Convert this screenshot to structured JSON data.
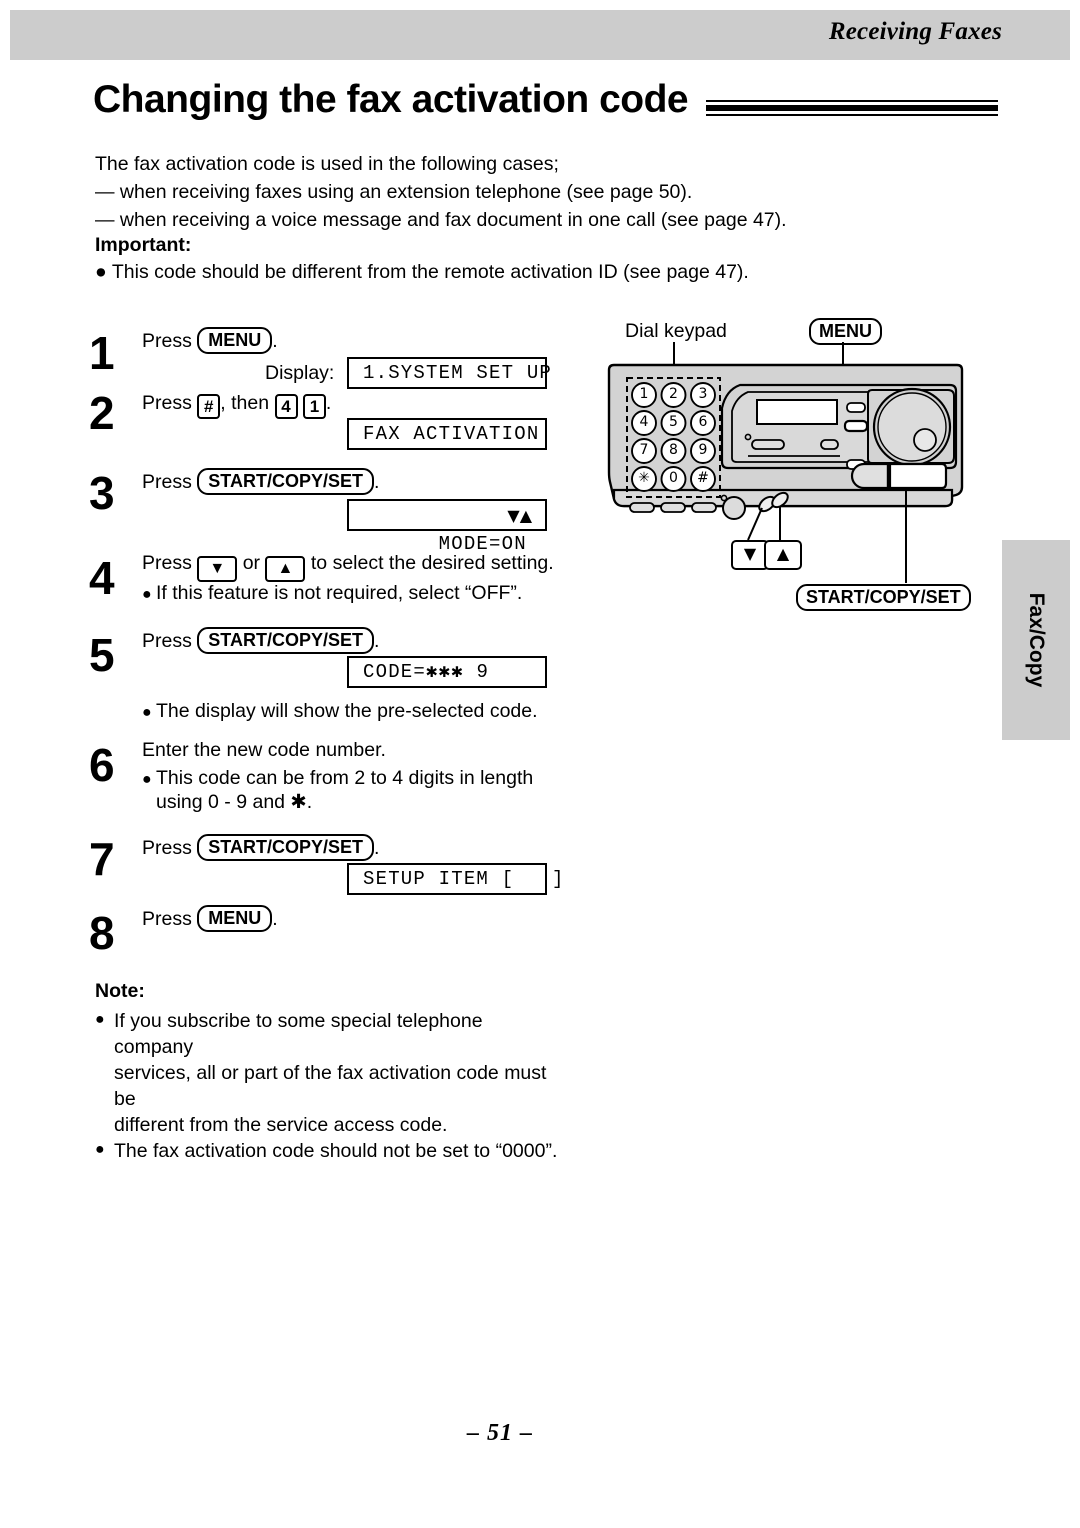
{
  "header": {
    "section_title": "Receiving Faxes"
  },
  "title": "Changing the fax activation code",
  "intro": {
    "line1": "The fax activation code is used in the following cases;",
    "line2": "— when receiving faxes using an extension telephone (see page 50).",
    "line3": "— when receiving a voice message and fax document in one call (see page 47)."
  },
  "important": {
    "label": "Important:",
    "item1": "This code should be different from the remote activation ID (see page 47)."
  },
  "steps": {
    "s1": {
      "num": "1",
      "press": "Press",
      "key": "MENU",
      "period": ".",
      "display_label": "Display:",
      "lcd": "1.SYSTEM SET UP"
    },
    "s2": {
      "num": "2",
      "press": "Press",
      "key_hash": "#",
      "then": ", then",
      "key_4": "4",
      "key_1": "1",
      "period": ".",
      "lcd": "FAX ACTIVATION"
    },
    "s3": {
      "num": "3",
      "press": "Press",
      "key": "START/COPY/SET",
      "period": ".",
      "lcd": "MODE=ON",
      "lcd_arrows": "▼▲"
    },
    "s4": {
      "num": "4",
      "press": "Press",
      "key_down": "▼",
      "or": "or",
      "key_up": "▲",
      "tail": "to select the desired setting.",
      "bullet1": "If this feature is not required, select “OFF”."
    },
    "s5": {
      "num": "5",
      "press": "Press",
      "key": "START/COPY/SET",
      "period": ".",
      "lcd": "CODE=✱✱✱ 9",
      "bullet1": "The display will show the pre-selected code."
    },
    "s6": {
      "num": "6",
      "text": "Enter the new code number.",
      "bullet1": "This code can be from 2 to 4 digits in length",
      "bullet1_cont": "using 0 - 9 and ✱."
    },
    "s7": {
      "num": "7",
      "press": "Press",
      "key": "START/COPY/SET",
      "period": ".",
      "lcd": "SETUP ITEM [   ]"
    },
    "s8": {
      "num": "8",
      "press": "Press",
      "key": "MENU",
      "period": "."
    }
  },
  "figure": {
    "dial_keypad_label": "Dial keypad",
    "menu_label": "MENU",
    "start_copy_set_label": "START/COPY/SET",
    "down_arrow": "▼",
    "up_arrow": "▲",
    "keypad_keys": [
      "1",
      "2",
      "3",
      "4",
      "5",
      "6",
      "7",
      "8",
      "9",
      "✳",
      "0",
      "#"
    ]
  },
  "side_tab": {
    "label": "Fax/Copy"
  },
  "note": {
    "label": "Note:",
    "items": [
      "If you subscribe to some special telephone company",
      "services, all or part of the fax activation code must be",
      "different from the service access code.",
      "The fax activation code should not be set to “0000”."
    ]
  },
  "footer": {
    "page_number": "– 51 –"
  },
  "colors": {
    "header_band": "#cccccc",
    "side_tab": "#cccccc",
    "ink": "#000000",
    "paper": "#ffffff"
  }
}
